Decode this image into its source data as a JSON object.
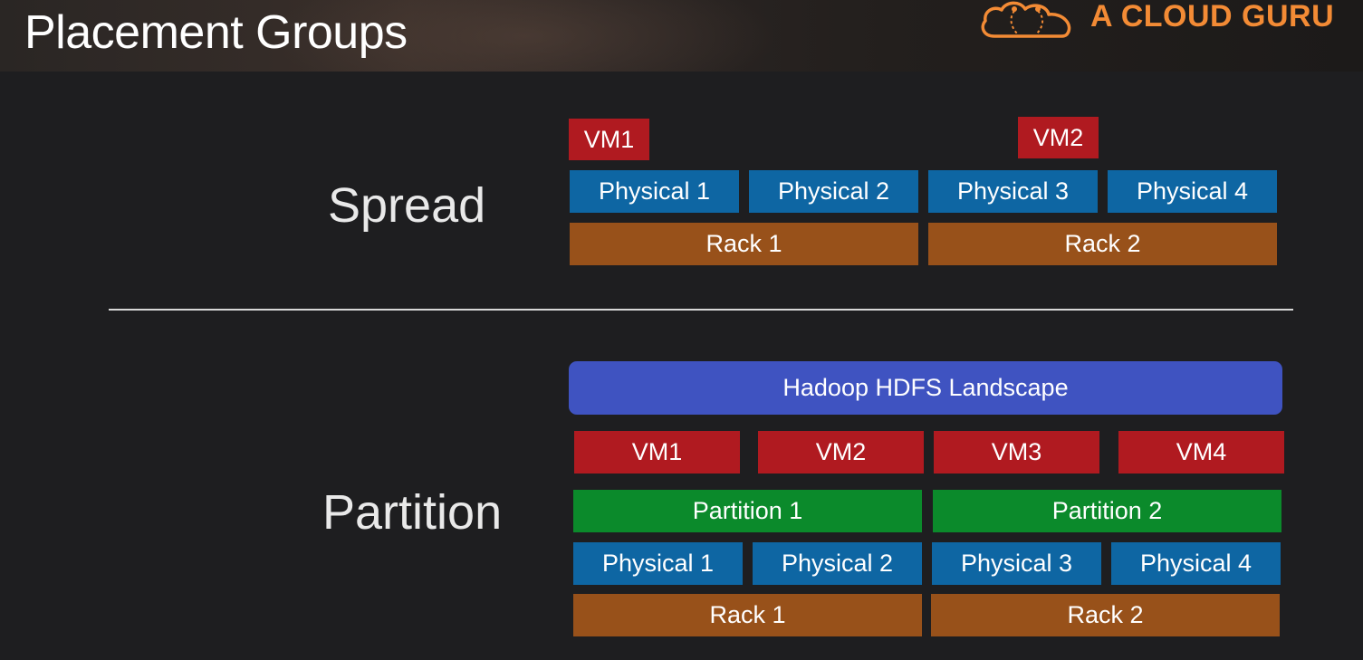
{
  "header": {
    "title": "Placement Groups",
    "logo_text": "A CLOUD GURU",
    "accent_color": "#f38b35"
  },
  "spread": {
    "label": "Spread",
    "vms": [
      "VM1",
      "VM2"
    ],
    "physicals": [
      "Physical 1",
      "Physical 2",
      "Physical 3",
      "Physical 4"
    ],
    "racks": [
      "Rack 1",
      "Rack 2"
    ]
  },
  "partition": {
    "label": "Partition",
    "landscape": "Hadoop HDFS Landscape",
    "vms": [
      "VM1",
      "VM2",
      "VM3",
      "VM4"
    ],
    "partitions": [
      "Partition 1",
      "Partition 2"
    ],
    "physicals": [
      "Physical 1",
      "Physical 2",
      "Physical 3",
      "Physical 4"
    ],
    "racks": [
      "Rack 1",
      "Rack 2"
    ]
  },
  "colors": {
    "vm": "#b01a20",
    "physical": "#0e66a3",
    "rack": "#98511a",
    "partition": "#0b8a2b",
    "landscape": "#3f53c1"
  }
}
